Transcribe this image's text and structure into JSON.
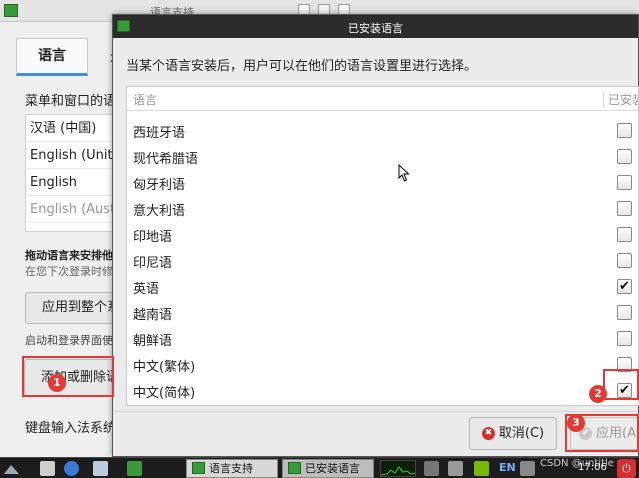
{
  "background_window": {
    "title": "语言支持",
    "tabs": [
      {
        "label": "语言"
      },
      {
        "label": "地"
      }
    ],
    "menu_language_label": "菜单和窗口的语",
    "languages": [
      {
        "label": "汉语 (中国)"
      },
      {
        "label": "English (Unit"
      },
      {
        "label": "English"
      },
      {
        "label": "English (Aust"
      }
    ],
    "drag_hint": "拖动语言来安排他",
    "drag_hint_sub": "在您下次登录时修",
    "apply_all_button": "应用到整个系",
    "login_text": "启动和登录界面使",
    "add_remove_button": "添加或删除语",
    "keyboard_label": "键盘输入法系统"
  },
  "dialog": {
    "title": "已安装语言",
    "description": "当某个语言安装后，用户可以在他们的语言设置里进行选择。",
    "columns": {
      "language": "语言",
      "installed": "已安装"
    },
    "rows": [
      {
        "name": "西班牙语",
        "installed": false
      },
      {
        "name": "现代希腊语",
        "installed": false
      },
      {
        "name": "匈牙利语",
        "installed": false
      },
      {
        "name": "意大利语",
        "installed": false
      },
      {
        "name": "印地语",
        "installed": false
      },
      {
        "name": "印尼语",
        "installed": false
      },
      {
        "name": "英语",
        "installed": true
      },
      {
        "name": "越南语",
        "installed": false
      },
      {
        "name": "朝鲜语",
        "installed": false
      },
      {
        "name": "中文(繁体)",
        "installed": false
      },
      {
        "name": "中文(简体)",
        "installed": true
      }
    ],
    "cancel_button": "取消(C)",
    "apply_button": "应用(A)"
  },
  "annotations": {
    "badge1": "1",
    "badge2": "2",
    "badge3": "3",
    "highlight_color": "#e53935"
  },
  "taskbar": {
    "tasks": [
      {
        "label": "语言支持"
      },
      {
        "label": "已安装语言"
      }
    ],
    "input_method": "EN",
    "watermark": "CSDN @untitle",
    "clock": "17:06"
  }
}
